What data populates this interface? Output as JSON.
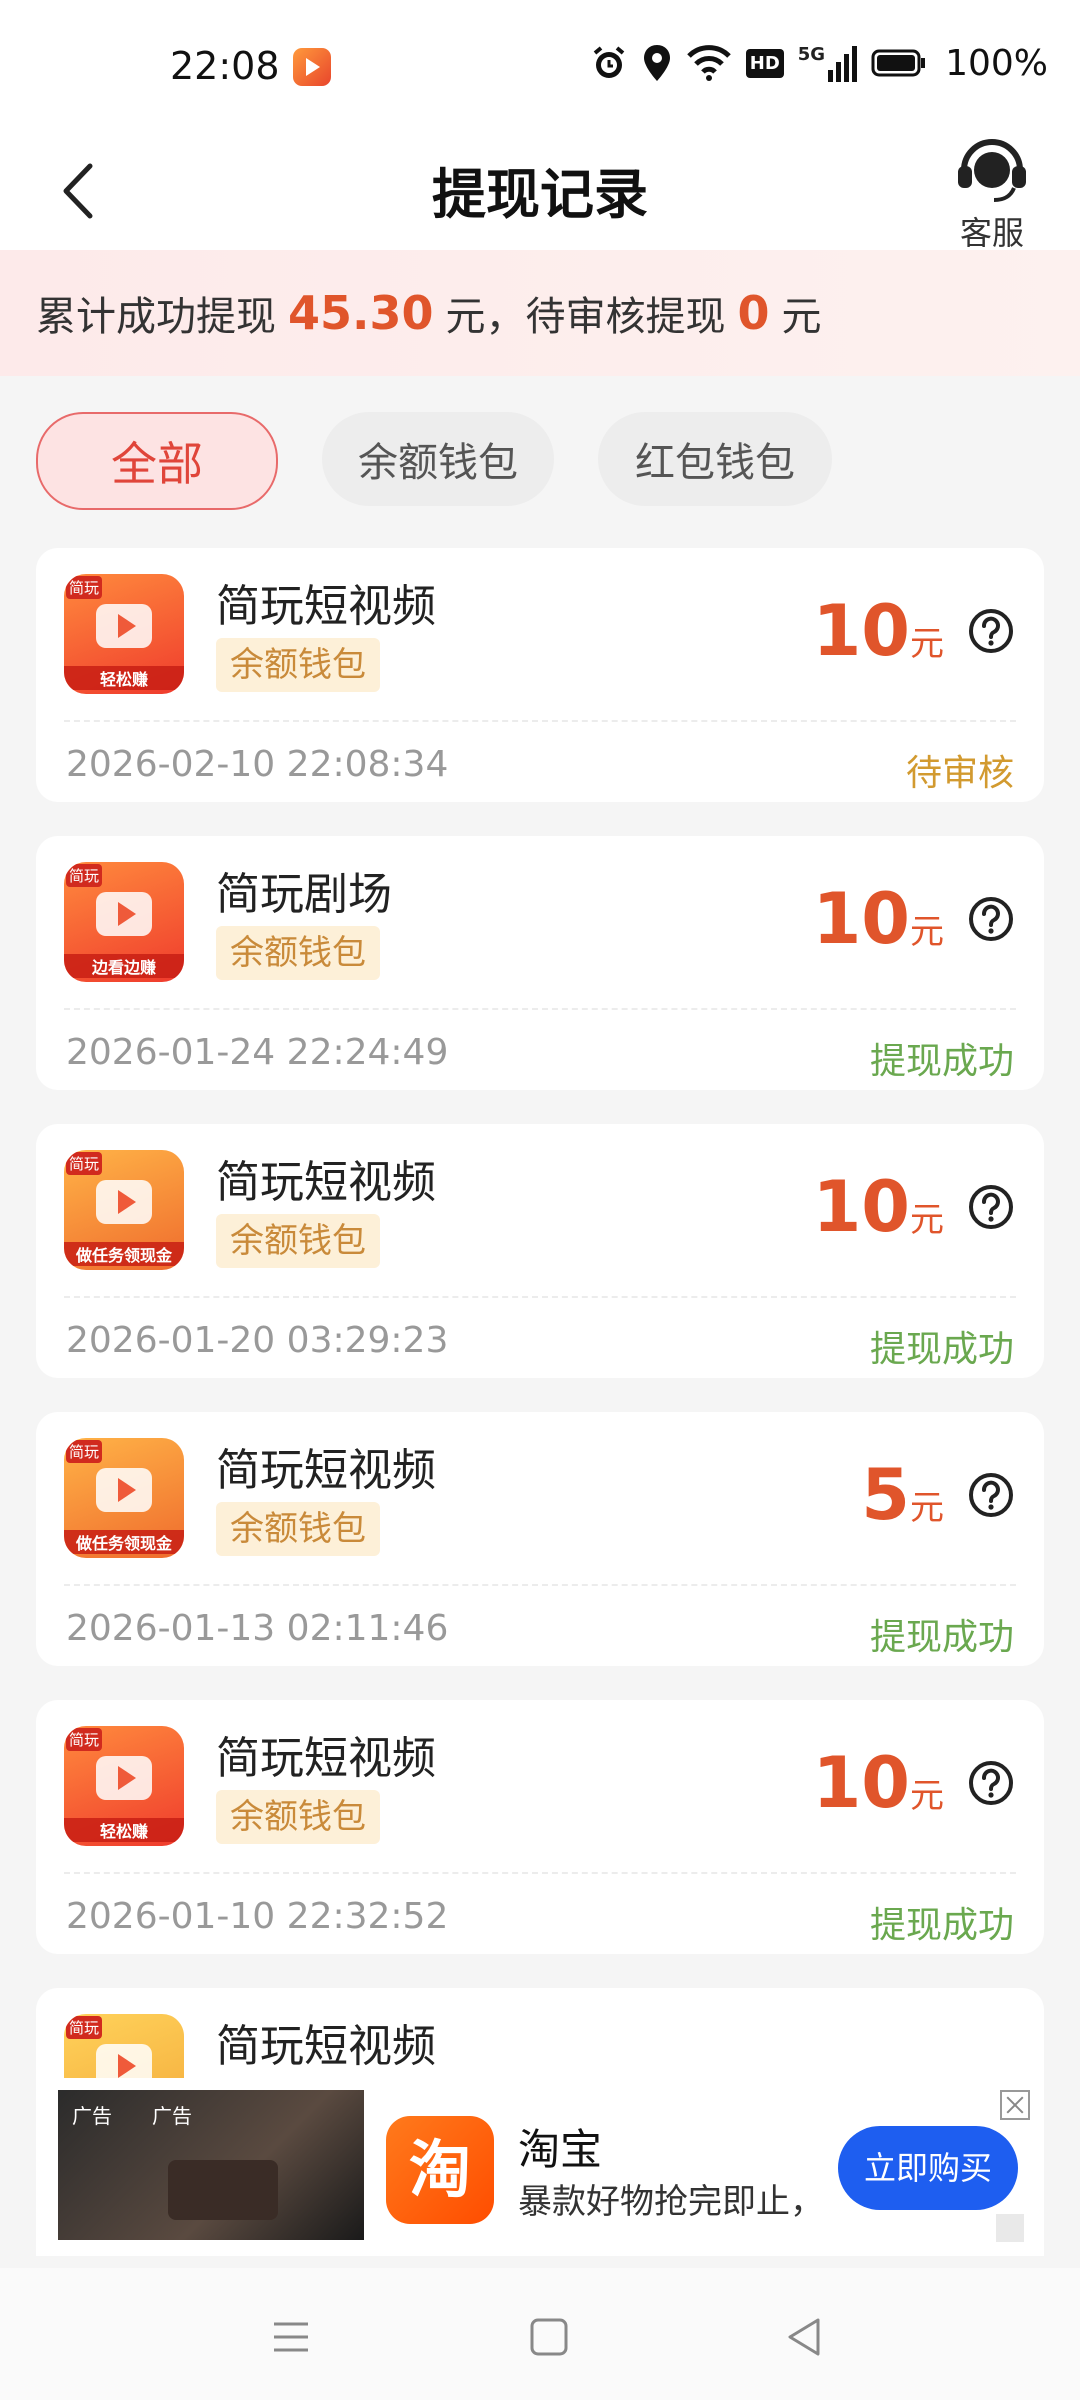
{
  "status_bar": {
    "time": "22:08",
    "network": "5G",
    "hd": "HD",
    "battery": "100%"
  },
  "header": {
    "title": "提现记录",
    "service_label": "客服"
  },
  "summary": {
    "prefix": "累计成功提现",
    "success_amount": "45.30",
    "mid_text": "元，待审核提现",
    "pending_amount": "0",
    "suffix": "元"
  },
  "tabs": [
    {
      "label": "全部",
      "active": true
    },
    {
      "label": "余额钱包",
      "active": false
    },
    {
      "label": "红包钱包",
      "active": false
    }
  ],
  "records": [
    {
      "app": "简玩短视频",
      "wallet": "余额钱包",
      "amount": "10",
      "unit": "元",
      "time": "2026-02-10 22:08:34",
      "status": "待审核",
      "icon_caption": "轻松赚"
    },
    {
      "app": "简玩剧场",
      "wallet": "余额钱包",
      "amount": "10",
      "unit": "元",
      "time": "2026-01-24 22:24:49",
      "status": "提现成功",
      "icon_caption": "边看边赚"
    },
    {
      "app": "简玩短视频",
      "wallet": "余额钱包",
      "amount": "10",
      "unit": "元",
      "time": "2026-01-20 03:29:23",
      "status": "提现成功",
      "icon_caption": "做任务领现金"
    },
    {
      "app": "简玩短视频",
      "wallet": "余额钱包",
      "amount": "5",
      "unit": "元",
      "time": "2026-01-13 02:11:46",
      "status": "提现成功",
      "icon_caption": "做任务领现金"
    },
    {
      "app": "简玩短视频",
      "wallet": "余额钱包",
      "amount": "10",
      "unit": "元",
      "time": "2026-01-10 22:32:52",
      "status": "提现成功",
      "icon_caption": "轻松赚"
    },
    {
      "app": "简玩短视频"
    }
  ],
  "icon_badge": "简玩",
  "ad": {
    "tag1": "广告",
    "tag2": "广告",
    "logo_char": "淘",
    "title": "淘宝",
    "desc": "暴款好物抢完即止，",
    "button": "立即购买"
  },
  "colors": {
    "accent": "#e0552b",
    "pending": "#d29a2f",
    "success": "#6aa84f",
    "tag_bg": "#fdf0d8",
    "ad_button": "#1e5ef0"
  }
}
